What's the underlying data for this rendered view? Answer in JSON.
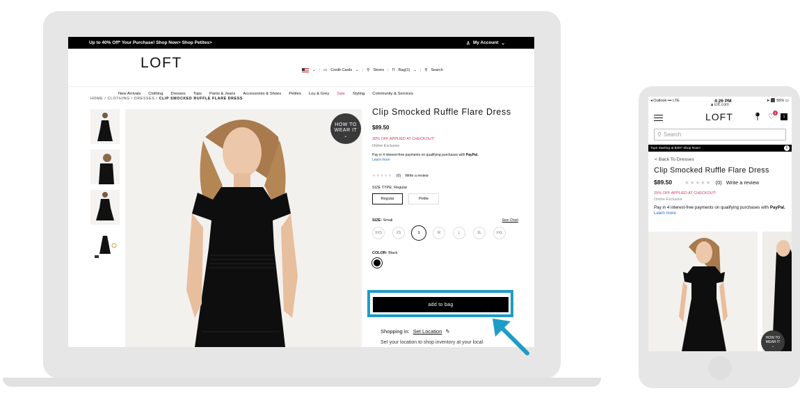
{
  "desktop": {
    "promo": {
      "text": "Up to 40% Off* Your Purchase! Shop Now> Shop Petites>",
      "account": "My Account"
    },
    "header": {
      "logo": "LOFT",
      "credit_cards": "Credit Cards",
      "stores": "Stores",
      "bag": "Bag(1)",
      "search": "Search"
    },
    "nav": [
      "New Arrivals",
      "Clothing",
      "Dresses",
      "Tops",
      "Pants & Jeans",
      "Accessories & Shoes",
      "Petites",
      "Lou & Grey",
      "Sale",
      "Styling",
      "Community & Services"
    ],
    "breadcrumb": {
      "home": "HOME",
      "clothing": "CLOTHING",
      "dresses": "DRESSES",
      "current": "CLIP SMOCKED RUFFLE FLARE DRESS"
    },
    "how_to_wear": {
      "line1": "HOW TO",
      "line2": "WEAR IT"
    },
    "product": {
      "title": "Clip Smocked Ruffle Flare Dress",
      "price": "$89.50",
      "promo": "30% OFF APPLIED AT CHECKOUT!",
      "exclusive": "Online Exclusive",
      "paypal_text": "Pay in 4 interest-free payments on qualifying purchases with",
      "paypal_brand": "PayPal.",
      "learn_more": "Learn more",
      "review_count": "(0)",
      "write_review": "Write a review",
      "size_type_label": "SIZE TYPE: Regular",
      "size_types": [
        "Regular",
        "Petite"
      ],
      "size_label_key": "SIZE:",
      "size_label_value": "Small",
      "size_chart": "Size Chart",
      "sizes": [
        "XXS",
        "XS",
        "S",
        "M",
        "L",
        "XL",
        "XXL"
      ],
      "selected_size": "S",
      "color_label_key": "COLOR:",
      "color_label_value": "Black",
      "add_to_bag": "add to bag",
      "shopping_in": "Shopping in:",
      "set_location": "Set Location",
      "set_location_text": "Set your location to shop inventory at your local"
    }
  },
  "mobile": {
    "status": {
      "carrier": "◂ Outlook",
      "signal": "LTE",
      "time": "4:26 PM",
      "battery": "55%",
      "url": "loft.com"
    },
    "logo": "LOFT",
    "badge_count": "1",
    "bag_count": "1",
    "search_placeholder": "Search",
    "banner": "Tops Starting at $29!* Shop Now>",
    "back": "< Back To Dresses",
    "title": "Clip Smocked Ruffle Flare Dress",
    "price": "$89.50",
    "review_count": "(0)",
    "write_review": "Write a review",
    "promo": "25% OFF APPLIED AT CHECKOUT!",
    "exclusive": "Online Exclusive",
    "paypal_text": "Pay in 4 interest-free payments on qualifying purchases with",
    "paypal_brand": "PayPal.",
    "learn_more": "Learn more",
    "how_to_wear": {
      "line1": "HOW TO",
      "line2": "WEAR IT"
    }
  },
  "colors": {
    "accent_highlight": "#1d9cc6",
    "sale": "#d0385b",
    "button": "#000000"
  }
}
